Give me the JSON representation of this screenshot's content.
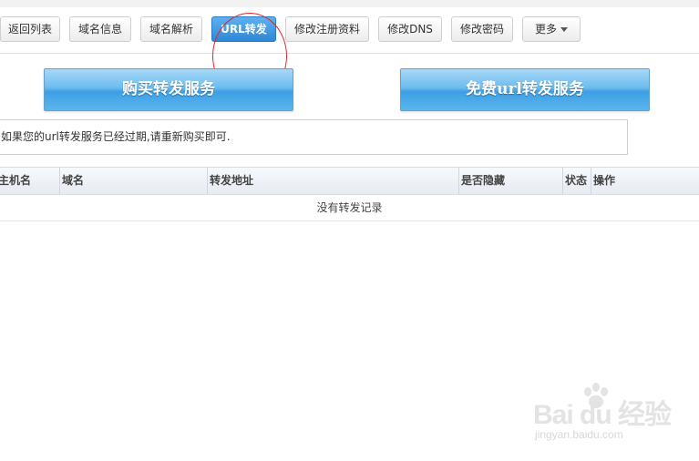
{
  "toolbar": {
    "buttons": [
      {
        "label": "返回列表"
      },
      {
        "label": "域名信息"
      },
      {
        "label": "域名解析"
      },
      {
        "label": "URL转发"
      },
      {
        "label": "修改注册资料"
      },
      {
        "label": "修改DNS"
      },
      {
        "label": "修改密码"
      },
      {
        "label": "更多"
      }
    ],
    "active_index": 3
  },
  "actions": {
    "buy_label": "购买转发服务",
    "free_label": "免费url转发服务"
  },
  "notice": {
    "text": "如果您的url转发服务已经过期,请重新购买即可."
  },
  "table": {
    "columns": [
      "主机名",
      "域名",
      "转发地址",
      "是否隐藏",
      "状态",
      "操作"
    ],
    "empty_text": "没有转发记录"
  },
  "watermark": {
    "main": "Bai du 经验",
    "sub": "jingyan.baidu.com"
  },
  "colors": {
    "active_button": "#2e88d6",
    "big_button": "#5cb6ec",
    "annotation": "#e3242b"
  }
}
